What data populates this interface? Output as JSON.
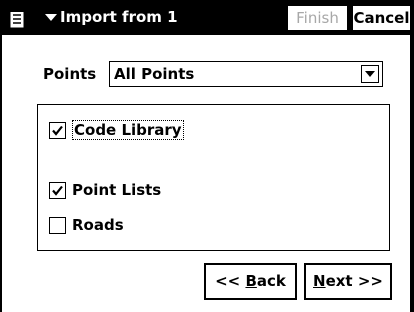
{
  "titlebar": {
    "menu_icon": "list-menu-icon",
    "title": "Import from 1",
    "finish_label": "Finish",
    "cancel_label": "Cancel"
  },
  "points": {
    "label": "Points",
    "selected": "All Points"
  },
  "options": [
    {
      "label": "Code Library",
      "checked": true,
      "focused": true
    },
    {
      "label": "Point Lists",
      "checked": true
    },
    {
      "label": "Roads",
      "checked": false
    }
  ],
  "nav": {
    "back_prefix": "<< ",
    "back_ul": "B",
    "back_rest": "ack",
    "next_ul": "N",
    "next_rest": "ext >>"
  },
  "colors": {
    "titlebar_bg": "#000000",
    "disabled_text": "#a8a8a8"
  }
}
